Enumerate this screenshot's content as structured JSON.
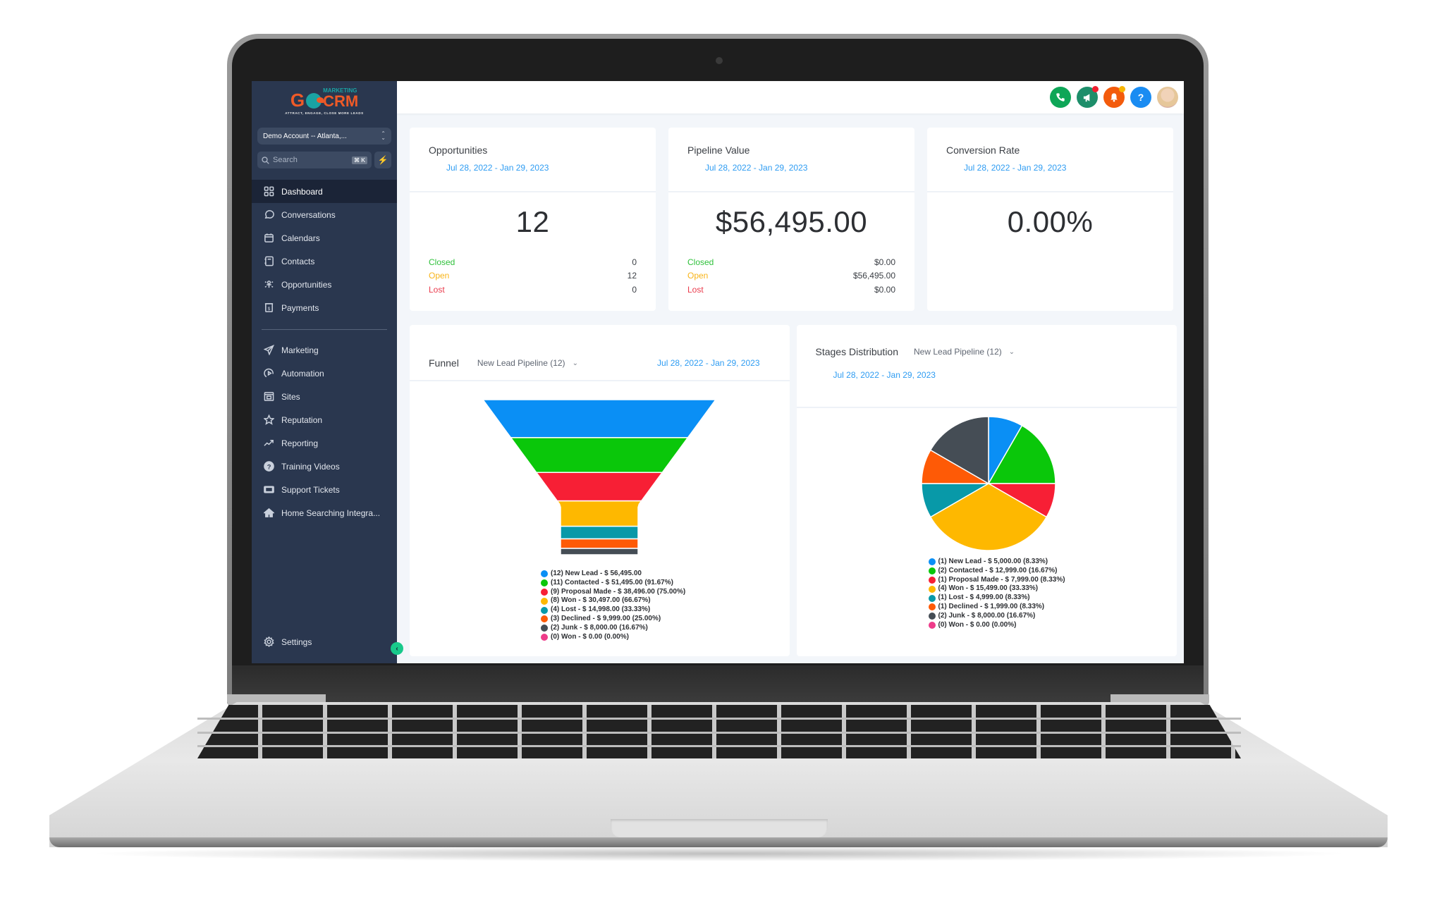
{
  "app": {
    "logo": {
      "brand_left": "G",
      "brand_top": "MARKETING",
      "brand_right": "CRM",
      "tagline": "ATTRACT, ENGAGE, CLOSE MORE LEADS"
    },
    "account_switcher": {
      "label": "Demo Account -- Atlanta,...",
      "icon": "up-down-chevron-icon"
    },
    "search": {
      "placeholder": "Search",
      "shortcut": "⌘ K",
      "icon": "search-icon"
    },
    "quick_action": {
      "icon": "lightning-bolt-icon",
      "color": "#18c98b"
    }
  },
  "sidebar": {
    "items": [
      {
        "label": "Dashboard",
        "icon": "dashboard-grid-icon",
        "active": true
      },
      {
        "label": "Conversations",
        "icon": "chat-bubble-icon"
      },
      {
        "label": "Calendars",
        "icon": "calendar-icon"
      },
      {
        "label": "Contacts",
        "icon": "contacts-book-icon"
      },
      {
        "label": "Opportunities",
        "icon": "opportunities-network-icon"
      },
      {
        "label": "Payments",
        "icon": "payments-receipt-icon"
      }
    ],
    "items2": [
      {
        "label": "Marketing",
        "icon": "paper-plane-icon"
      },
      {
        "label": "Automation",
        "icon": "automation-play-icon"
      },
      {
        "label": "Sites",
        "icon": "browser-window-icon"
      },
      {
        "label": "Reputation",
        "icon": "star-icon"
      },
      {
        "label": "Reporting",
        "icon": "trend-up-icon"
      },
      {
        "label": "Training Videos",
        "icon": "question-circle-icon"
      },
      {
        "label": "Support Tickets",
        "icon": "ticket-icon"
      },
      {
        "label": "Home Searching Integra...",
        "icon": "home-icon"
      }
    ],
    "settings": {
      "label": "Settings",
      "icon": "gear-icon"
    },
    "collapse": {
      "icon": "chevron-left-icon"
    }
  },
  "topbar": {
    "buttons": [
      {
        "name": "phone",
        "icon": "phone-icon",
        "glyph": "✆",
        "color": "#0ea657"
      },
      {
        "name": "announcements",
        "icon": "megaphone-icon",
        "glyph": "📢",
        "color": "#1d8e6a",
        "badge_color": "#ef1f2f"
      },
      {
        "name": "notifications",
        "icon": "bell-icon",
        "glyph": "🔔",
        "color": "#f35b0c",
        "badge_color": "#f8b500"
      },
      {
        "name": "help",
        "icon": "question-icon",
        "glyph": "?",
        "color": "#1a8cf2"
      }
    ],
    "avatar": "user-avatar"
  },
  "cards": [
    {
      "title": "Opportunities",
      "date_range": "Jul 28, 2022 - Jan 29, 2023",
      "value": "12",
      "stats": [
        {
          "label": "Closed",
          "value": "0",
          "color": "#2fc13b"
        },
        {
          "label": "Open",
          "value": "12",
          "color": "#f8b418"
        },
        {
          "label": "Lost",
          "value": "0",
          "color": "#ea3b4c"
        }
      ]
    },
    {
      "title": "Pipeline Value",
      "date_range": "Jul 28, 2022 - Jan 29, 2023",
      "value": "$56,495.00",
      "stats": [
        {
          "label": "Closed",
          "value": "$0.00",
          "color": "#2fc13b"
        },
        {
          "label": "Open",
          "value": "$56,495.00",
          "color": "#f8b418"
        },
        {
          "label": "Lost",
          "value": "$0.00",
          "color": "#ea3b4c"
        }
      ]
    },
    {
      "title": "Conversion Rate",
      "date_range": "Jul 28, 2022 - Jan 29, 2023",
      "value": "0.00%",
      "stats": []
    }
  ],
  "funnel_panel": {
    "title": "Funnel",
    "pipeline": "New Lead Pipeline (12)",
    "date_range": "Jul 28, 2022 - Jan 29, 2023"
  },
  "stages_panel": {
    "title": "Stages Distribution",
    "pipeline": "New Lead Pipeline (12)",
    "date_range": "Jul 28, 2022 - Jan 29, 2023"
  },
  "chart_data": [
    {
      "type": "funnel",
      "title": "Funnel",
      "categories": [
        "New Lead",
        "Contacted",
        "Proposal Made",
        "Won",
        "Lost",
        "Declined",
        "Junk",
        "Won"
      ],
      "counts": [
        12,
        11,
        9,
        8,
        4,
        3,
        2,
        0
      ],
      "values": [
        56495.0,
        51495.0,
        38496.0,
        30497.0,
        14998.0,
        9999.0,
        8000.0,
        0.0
      ],
      "percent": [
        null,
        91.67,
        75.0,
        66.67,
        33.33,
        25.0,
        16.67,
        0.0
      ],
      "colors": [
        "#0a8ff5",
        "#0ac70a",
        "#f71f35",
        "#feb800",
        "#0899a8",
        "#fe5a06",
        "#454d55",
        "#ee3c8a"
      ],
      "legend": [
        "(12) New Lead - $ 56,495.00",
        "(11) Contacted - $ 51,495.00 (91.67%)",
        "(9) Proposal Made - $ 38,496.00 (75.00%)",
        "(8) Won - $ 30,497.00 (66.67%)",
        "(4) Lost - $ 14,998.00 (33.33%)",
        "(3) Declined - $ 9,999.00 (25.00%)",
        "(2) Junk - $ 8,000.00 (16.67%)",
        "(0) Won - $ 0.00 (0.00%)"
      ],
      "legend_position": "bottom"
    },
    {
      "type": "pie",
      "title": "Stages Distribution",
      "categories": [
        "New Lead",
        "Contacted",
        "Proposal Made",
        "Won",
        "Lost",
        "Declined",
        "Junk",
        "Won"
      ],
      "counts": [
        1,
        2,
        1,
        4,
        1,
        1,
        2,
        0
      ],
      "values": [
        5000.0,
        12999.0,
        7999.0,
        15499.0,
        4999.0,
        1999.0,
        8000.0,
        0.0
      ],
      "percent": [
        8.33,
        16.67,
        8.33,
        33.33,
        8.33,
        8.33,
        16.67,
        0.0
      ],
      "colors": [
        "#0a8ff5",
        "#0ac70a",
        "#f71f35",
        "#feb800",
        "#0899a8",
        "#fe5a06",
        "#454d55",
        "#ee3c8a"
      ],
      "legend": [
        "(1) New Lead - $ 5,000.00 (8.33%)",
        "(2) Contacted - $ 12,999.00 (16.67%)",
        "(1) Proposal Made - $ 7,999.00 (8.33%)",
        "(4) Won - $ 15,499.00 (33.33%)",
        "(1) Lost - $ 4,999.00 (8.33%)",
        "(1) Declined - $ 1,999.00 (8.33%)",
        "(2) Junk - $ 8,000.00 (16.67%)",
        "(0) Won - $ 0.00 (0.00%)"
      ],
      "legend_position": "bottom"
    }
  ]
}
